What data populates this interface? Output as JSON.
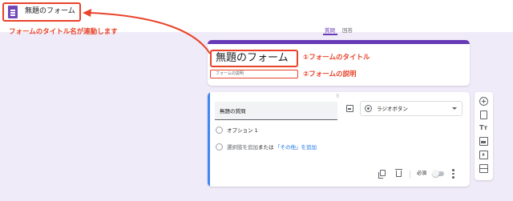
{
  "app": {
    "title": "無題のフォーム"
  },
  "annotations": {
    "sync": "フォームのタイトル名が連動します",
    "title_note": "①フォームのタイトル",
    "desc_note": "②フォームの説明"
  },
  "tabs": [
    {
      "label": "質問",
      "active": true
    },
    {
      "label": "回答",
      "active": false
    }
  ],
  "header": {
    "form_title": "無題のフォーム",
    "description_placeholder": "フォームの説明"
  },
  "question": {
    "title": "無題の質問",
    "type": "ラジオボタン",
    "option1": "オプション 1",
    "add_option": "選択肢を追加",
    "or": "または",
    "add_other": "「その他」を追加",
    "required_label": "必須"
  },
  "colors": {
    "accent": "#673ab7",
    "annotation": "#e8432a",
    "link": "#1a73e8",
    "focus": "#4285f4"
  },
  "icons": [
    "form-icon",
    "image-icon",
    "radio-icon",
    "dropdown-icon",
    "copy-icon",
    "delete-icon",
    "more-icon",
    "add-question-icon",
    "import-icon",
    "title-icon",
    "image-icon",
    "video-icon",
    "section-icon"
  ]
}
